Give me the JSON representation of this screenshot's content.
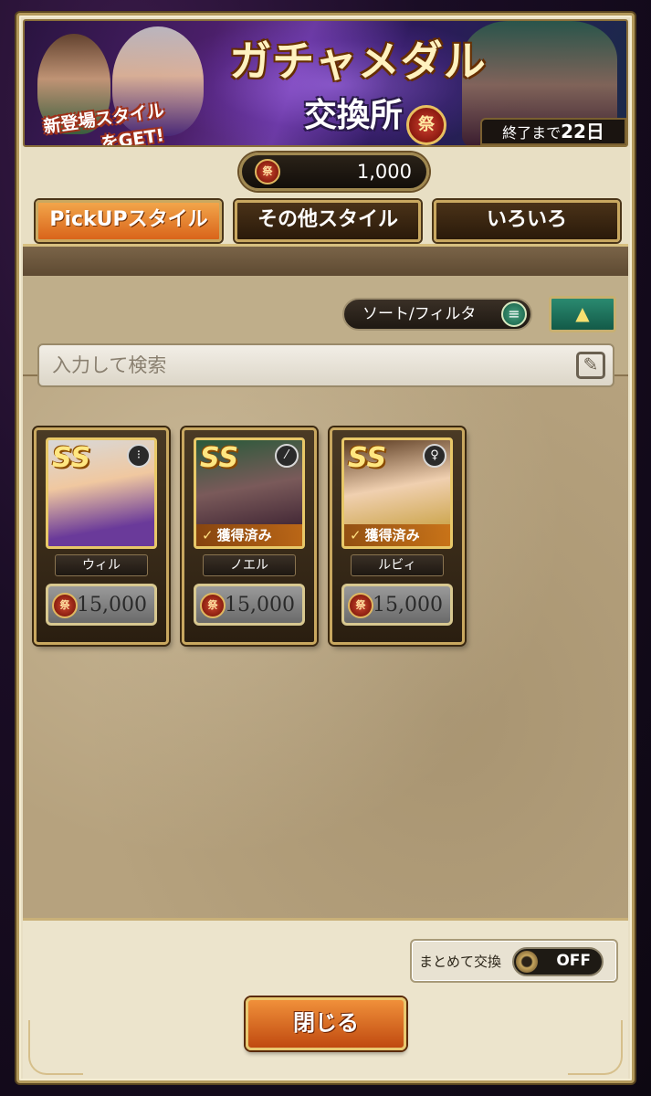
{
  "banner": {
    "title": "ガチャメダル",
    "subtitle": "交換所",
    "tag_line1": "新登場スタイル",
    "tag_line2": "をGET!",
    "medal_glyph": "祭",
    "end_prefix": "終了まで",
    "end_days": "22日"
  },
  "currency": {
    "icon": "祭",
    "amount": "1,000"
  },
  "tabs": [
    {
      "label": "PickUPスタイル",
      "active": true
    },
    {
      "label": "その他スタイル",
      "active": false
    },
    {
      "label": "いろいろ",
      "active": false
    }
  ],
  "filter": {
    "sort_label": "ソート/フィルタ",
    "sort_icon": "≡",
    "collapse_icon": "▲",
    "search_placeholder": "入力して検索",
    "edit_icon": "✎"
  },
  "cards": [
    {
      "rank": "SS",
      "name": "ウィル",
      "price_icon": "祭",
      "price": "15,000",
      "weapon_icon": "⁝",
      "obtained": ""
    },
    {
      "rank": "SS",
      "name": "ノエル",
      "price_icon": "祭",
      "price": "15,000",
      "weapon_icon": "⁄",
      "obtained": "獲得済み",
      "check": "✓"
    },
    {
      "rank": "SS",
      "name": "ルビィ",
      "price_icon": "祭",
      "price": "15,000",
      "weapon_icon": "♀",
      "obtained": "獲得済み",
      "check": "✓"
    }
  ],
  "bulk": {
    "label": "まとめて交換",
    "state": "OFF"
  },
  "close_button": "閉じる",
  "colors": {
    "accent": "#d9641a",
    "panel": "#b6a27e",
    "frame": "#c9a860"
  }
}
